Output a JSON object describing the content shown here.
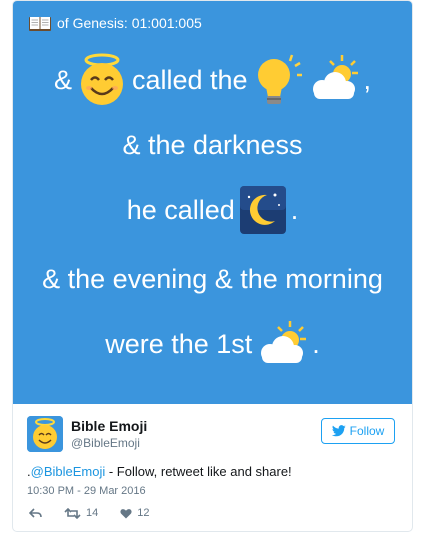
{
  "tweet": {
    "verse_ref": "of Genesis: 01:001:005",
    "lines": {
      "l1_prefix": "&",
      "l1_text": "called the",
      "l1_suffix": ",",
      "l2": "& the darkness",
      "l3_text": "he called",
      "l3_suffix": ".",
      "l4": "& the evening & the morning",
      "l5_text": "were the 1st",
      "l5_suffix": "."
    },
    "emoji": [
      "open-book-icon",
      "smiling-face-with-halo-icon",
      "light-bulb-icon",
      "sun-behind-cloud-icon",
      "crescent-moon-night-icon",
      "sun-behind-cloud-icon"
    ],
    "author": {
      "name": "Bible Emoji",
      "handle": "@BibleEmoji"
    },
    "follow_label": "Follow",
    "text_prefix": ".",
    "mention": "@BibleEmoji",
    "text_body": " - Follow, retweet like and share!",
    "timestamp": "10:30 PM - 29 Mar 2016",
    "retweets": "14",
    "likes": "12"
  },
  "colors": {
    "media_bg": "#3b95dd",
    "link": "#1b95e0",
    "follow": "#1da1f2",
    "muted": "#657786"
  }
}
